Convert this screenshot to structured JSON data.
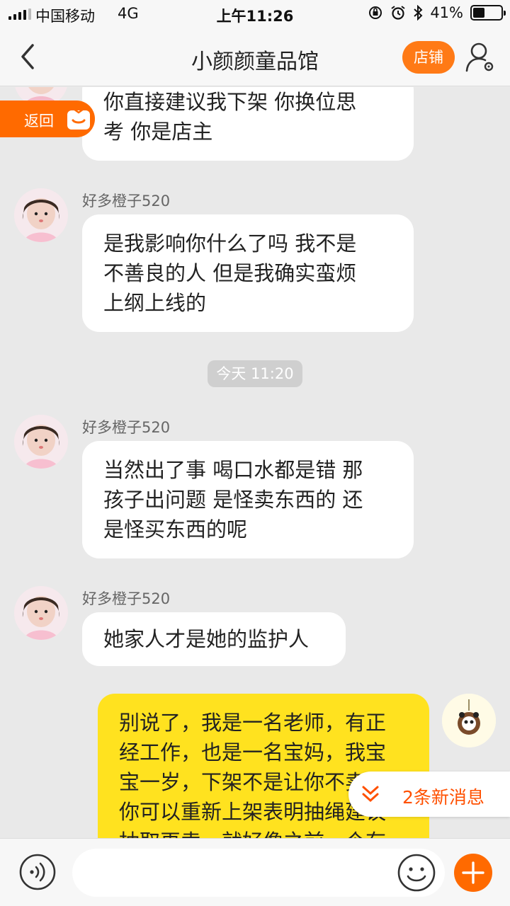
{
  "status": {
    "carrier": "中国移动",
    "network": "4G",
    "time": "上午11:26",
    "battery": "41%",
    "battery_level": 0.41
  },
  "nav": {
    "title": "小颜颜童品馆",
    "shop_button": "店铺"
  },
  "back_tab": {
    "label": "返回"
  },
  "messages": [
    {
      "sender": "",
      "text_lines": [
        "你直接建议我下架 你换位思",
        "考 你是店主"
      ]
    },
    {
      "sender": "好多橙子520",
      "text_lines": [
        "是我影响你什么了吗 我不是",
        "不善良的人 但是我确实蛮烦",
        "上纲上线的"
      ]
    },
    {
      "sender": "好多橙子520",
      "text_lines": [
        "当然出了事  喝口水都是错 那",
        "孩子出问题 是怪卖东西的 还",
        "是怪买东西的呢"
      ]
    },
    {
      "sender": "好多橙子520",
      "text_lines": [
        "她家人才是她的监护人"
      ]
    }
  ],
  "time_divider": "今天 11:20",
  "my_message": {
    "text_lines": [
      "别说了，我是一名老师，有正",
      "经工作，也是一名宝妈，我宝",
      "宝一岁，下架不是让你不卖，",
      "你可以重新上架表明抽绳建议",
      "抽取再卖，就好像之前一个有"
    ]
  },
  "new_messages": "2条新消息",
  "input": {
    "placeholder": "",
    "value": ""
  },
  "colors": {
    "accent": "#ff7a16",
    "my_bubble": "#ffe21f",
    "new_msg_text": "#ff5000"
  }
}
